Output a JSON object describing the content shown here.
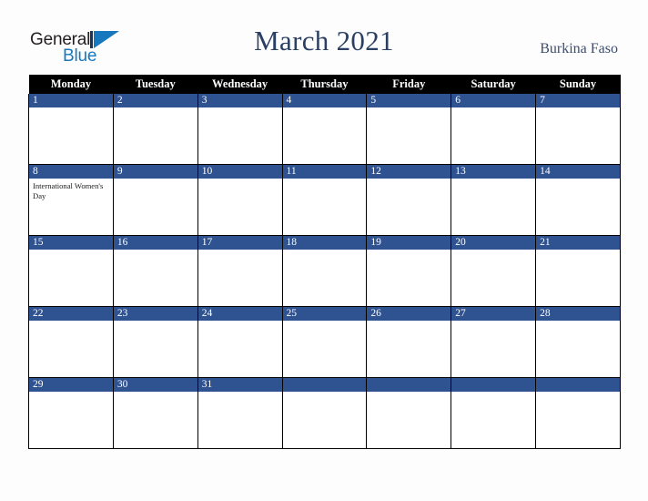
{
  "brand": {
    "name_part1": "General",
    "name_part2": "Blue",
    "mark_icon": "triangle-flag-icon",
    "color_primary": "#1878be",
    "color_dark": "#231f20"
  },
  "header": {
    "title": "March 2021",
    "country": "Burkina Faso",
    "title_color": "#2a3f63",
    "country_color": "#3c4d70"
  },
  "calendar": {
    "weekday_headers": [
      "Monday",
      "Tuesday",
      "Wednesday",
      "Thursday",
      "Friday",
      "Saturday",
      "Sunday"
    ],
    "header_bg": "#000000",
    "header_text_color": "#ffffff",
    "daynum_bg": "#2f5291",
    "daynum_text_color": "#ffffff",
    "cell_bg": "#ffffff",
    "grid_color": "#000000",
    "weeks": [
      [
        {
          "day": "1",
          "events": []
        },
        {
          "day": "2",
          "events": []
        },
        {
          "day": "3",
          "events": []
        },
        {
          "day": "4",
          "events": []
        },
        {
          "day": "5",
          "events": []
        },
        {
          "day": "6",
          "events": []
        },
        {
          "day": "7",
          "events": []
        }
      ],
      [
        {
          "day": "8",
          "events": [
            "International Women's Day"
          ]
        },
        {
          "day": "9",
          "events": []
        },
        {
          "day": "10",
          "events": []
        },
        {
          "day": "11",
          "events": []
        },
        {
          "day": "12",
          "events": []
        },
        {
          "day": "13",
          "events": []
        },
        {
          "day": "14",
          "events": []
        }
      ],
      [
        {
          "day": "15",
          "events": []
        },
        {
          "day": "16",
          "events": []
        },
        {
          "day": "17",
          "events": []
        },
        {
          "day": "18",
          "events": []
        },
        {
          "day": "19",
          "events": []
        },
        {
          "day": "20",
          "events": []
        },
        {
          "day": "21",
          "events": []
        }
      ],
      [
        {
          "day": "22",
          "events": []
        },
        {
          "day": "23",
          "events": []
        },
        {
          "day": "24",
          "events": []
        },
        {
          "day": "25",
          "events": []
        },
        {
          "day": "26",
          "events": []
        },
        {
          "day": "27",
          "events": []
        },
        {
          "day": "28",
          "events": []
        }
      ],
      [
        {
          "day": "29",
          "events": []
        },
        {
          "day": "30",
          "events": []
        },
        {
          "day": "31",
          "events": []
        },
        {
          "day": "",
          "events": []
        },
        {
          "day": "",
          "events": []
        },
        {
          "day": "",
          "events": []
        },
        {
          "day": "",
          "events": []
        }
      ]
    ]
  }
}
